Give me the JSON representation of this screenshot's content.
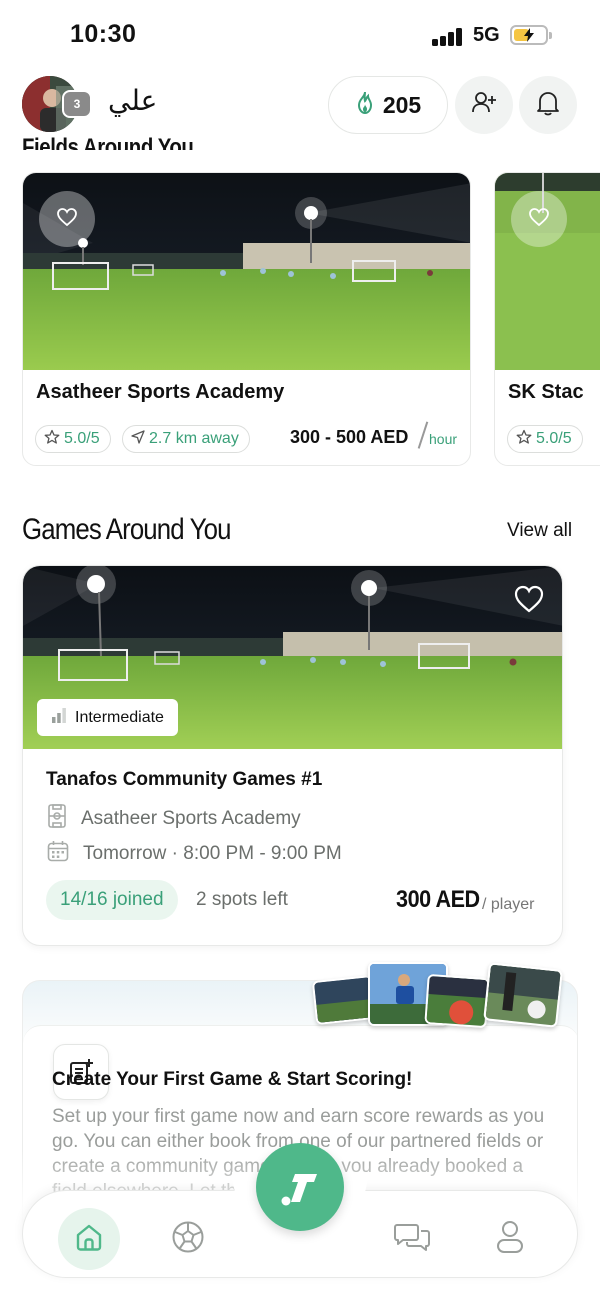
{
  "status_bar": {
    "time": "10:30",
    "network": "5G"
  },
  "header": {
    "avatar_level": "3",
    "user_name": "علي",
    "points": "205"
  },
  "fields_section": {
    "heading": "Fields Around You",
    "cards": [
      {
        "name": "Asatheer Sports Academy",
        "rating": "5.0/5",
        "distance": "2.7 km away",
        "price": "300 - 500 AED",
        "unit": "hour"
      },
      {
        "name": "SK Stac",
        "rating": "5.0/5"
      }
    ]
  },
  "games_section": {
    "heading": "Games Around You",
    "view_all": "View all",
    "game": {
      "level": "Intermediate",
      "title": "Tanafos Community Games #1",
      "venue": "Asatheer Sports Academy",
      "time": "Tomorrow · 8:00 PM - 9:00 PM",
      "joined": "14/16 joined",
      "spots_left": "2 spots left",
      "price": "300 AED",
      "price_unit": "/ player"
    }
  },
  "create_game": {
    "title": "Create Your First Game & Start Scoring!",
    "description": "Set up your first game now and earn score rewards as you go. You can either book from one of our partnered fields or create a community game in case you already booked a field elsewhere. Let the game begin!"
  },
  "bottom_nav": {
    "items": [
      "home-icon",
      "football-icon",
      "create-game-icon",
      "chat-icon",
      "profile-icon"
    ],
    "active": "home-icon"
  },
  "colors": {
    "accent": "#4fb88a",
    "accent_text": "#3aa079",
    "accent_soft": "#eaf6ef"
  }
}
